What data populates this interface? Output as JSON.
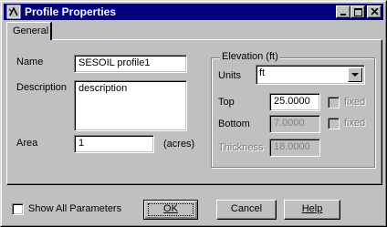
{
  "window": {
    "title": "Profile Properties",
    "icon": "profile-icon"
  },
  "titlebar_buttons": {
    "minimize": "minimize-icon",
    "maximize": "maximize-icon",
    "close": "close-icon"
  },
  "tabs": [
    {
      "label": "General",
      "selected": true
    }
  ],
  "form": {
    "name_label": "Name",
    "name_value": "SESOIL profile1",
    "description_label": "Description",
    "description_value": "description",
    "area_label": "Area",
    "area_value": "1",
    "area_unit": "(acres)"
  },
  "elevation": {
    "group_title": "Elevation (ft)",
    "units_label": "Units",
    "units_value": "ft",
    "top_label": "Top",
    "top_value": "25.0000",
    "top_fixed_label": "fixed",
    "bottom_label": "Bottom",
    "bottom_value": "7.0000",
    "bottom_fixed_label": "fixed",
    "thickness_label": "Thickness",
    "thickness_value": "18.0000"
  },
  "footer": {
    "show_all_label": "Show All Parameters",
    "ok_label": "OK",
    "cancel_label": "Cancel",
    "help_label": "Help"
  },
  "colors": {
    "titlebar": "#000080",
    "face": "#c0c0c0",
    "disabled_text": "#808080"
  }
}
